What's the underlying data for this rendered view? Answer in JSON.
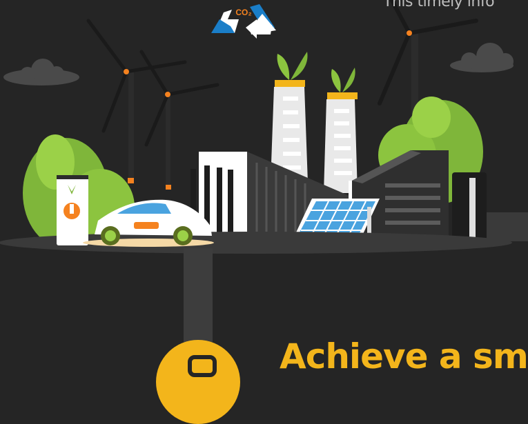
{
  "intro": {
    "text": "This timely info"
  },
  "headline": {
    "text": "Achieve a sm"
  },
  "icons": {
    "co2_recycle": "co2-recycle-icon",
    "co2_label": "CO₂",
    "leaf": "leaf-icon",
    "charging": "charging-icon",
    "badge_glyph": "lock-icon"
  },
  "colors": {
    "background": "#252525",
    "accent": "#f3b51b",
    "intro_text": "#bdbdbd",
    "recycle_blue": "#1a7ec8",
    "foliage_green": "#7fb63a",
    "charging_orange": "#f5821f"
  }
}
